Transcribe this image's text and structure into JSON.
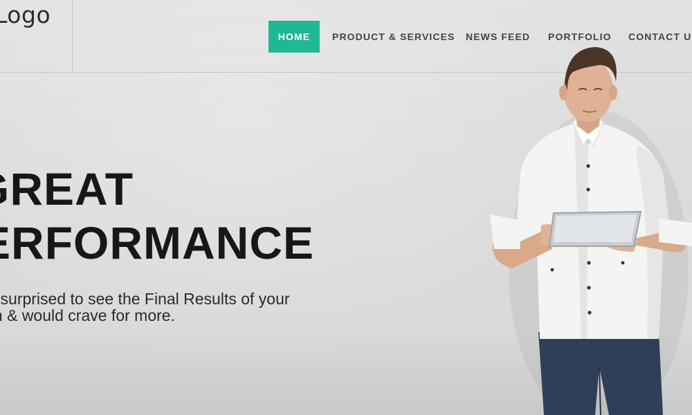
{
  "header": {
    "logo": "Logo",
    "nav": [
      {
        "label": "HOME",
        "active": true
      },
      {
        "label": "PRODUCT & SERVICES",
        "active": false
      },
      {
        "label": "NEWS FEED",
        "active": false
      },
      {
        "label": "PORTFOLIO",
        "active": false
      },
      {
        "label": "CONTACT US",
        "active": false
      }
    ],
    "accent_color": "#1fb794"
  },
  "hero": {
    "title_line_1": "GREAT",
    "title_line_2": "PERFORMANCE",
    "subtitle_line_1": "Be surprised to see the Final Results of your",
    "subtitle_line_2": "Brain & would crave for more."
  }
}
